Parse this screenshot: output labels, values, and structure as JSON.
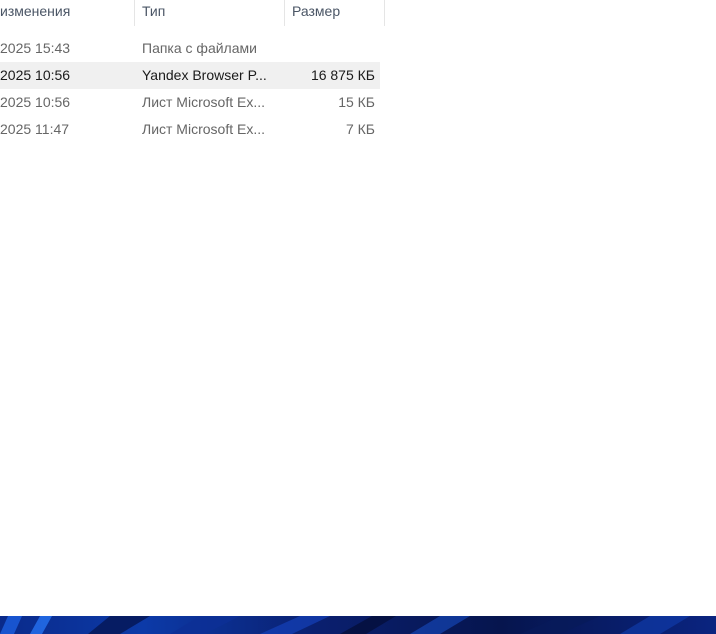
{
  "columns": {
    "date_modified": "изменения",
    "type": "Тип",
    "size": "Размер"
  },
  "files": [
    {
      "date": "2025 15:43",
      "type": "Папка с файлами",
      "size": "",
      "selected": false
    },
    {
      "date": "2025 10:56",
      "type": "Yandex Browser P...",
      "size": "16 875 КБ",
      "selected": true
    },
    {
      "date": "2025 10:56",
      "type": "Лист Microsoft Ex...",
      "size": "15 КБ",
      "selected": false
    },
    {
      "date": "2025 11:47",
      "type": "Лист Microsoft Ex...",
      "size": "7 КБ",
      "selected": false
    }
  ],
  "colors": {
    "selected_row_bg": "#f0f0f0",
    "header_text": "#4a5565",
    "row_text": "#666666",
    "taskbar_base": "#0c3aa8"
  }
}
